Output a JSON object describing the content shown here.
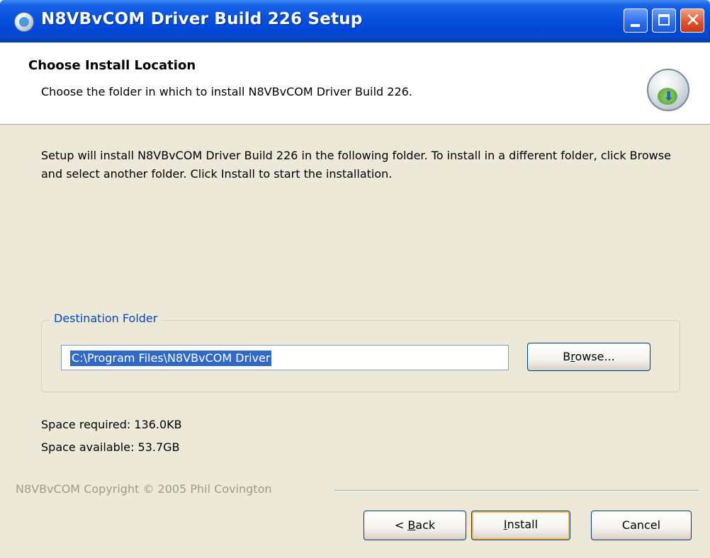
{
  "window": {
    "title": "N8VBvCOM Driver Build 226 Setup"
  },
  "header": {
    "title": "Choose Install Location",
    "subtitle": "Choose the folder in which to install N8VBvCOM Driver Build 226."
  },
  "body": {
    "intro": "Setup will install N8VBvCOM Driver Build 226 in the following folder. To install in a different folder, click Browse and select another folder. Click Install to start the installation."
  },
  "destination": {
    "group_label": "Destination Folder",
    "path": "C:\\Program Files\\N8VBvCOM Driver",
    "browse_pre": "B",
    "browse_ul": "r",
    "browse_post": "owse..."
  },
  "space": {
    "required": "Space required: 136.0KB",
    "available": "Space available: 53.7GB"
  },
  "footer": {
    "branding": "N8VBvCOM Copyright © 2005 Phil Covington",
    "back_pre": "< ",
    "back_ul": "B",
    "back_post": "ack",
    "install_ul": "I",
    "install_post": "nstall",
    "cancel": "Cancel"
  },
  "icons": {
    "app": "installer-disc-icon",
    "header_logo": "install-globe-icon",
    "minimize": "minimize-icon",
    "maximize": "maximize-icon",
    "close": "close-icon"
  },
  "colors": {
    "titlebar": "#0a54de",
    "dialog_bg": "#ece9d8",
    "selection": "#316ac5",
    "group_label": "#0046d5",
    "close_button": "#e2552f"
  }
}
